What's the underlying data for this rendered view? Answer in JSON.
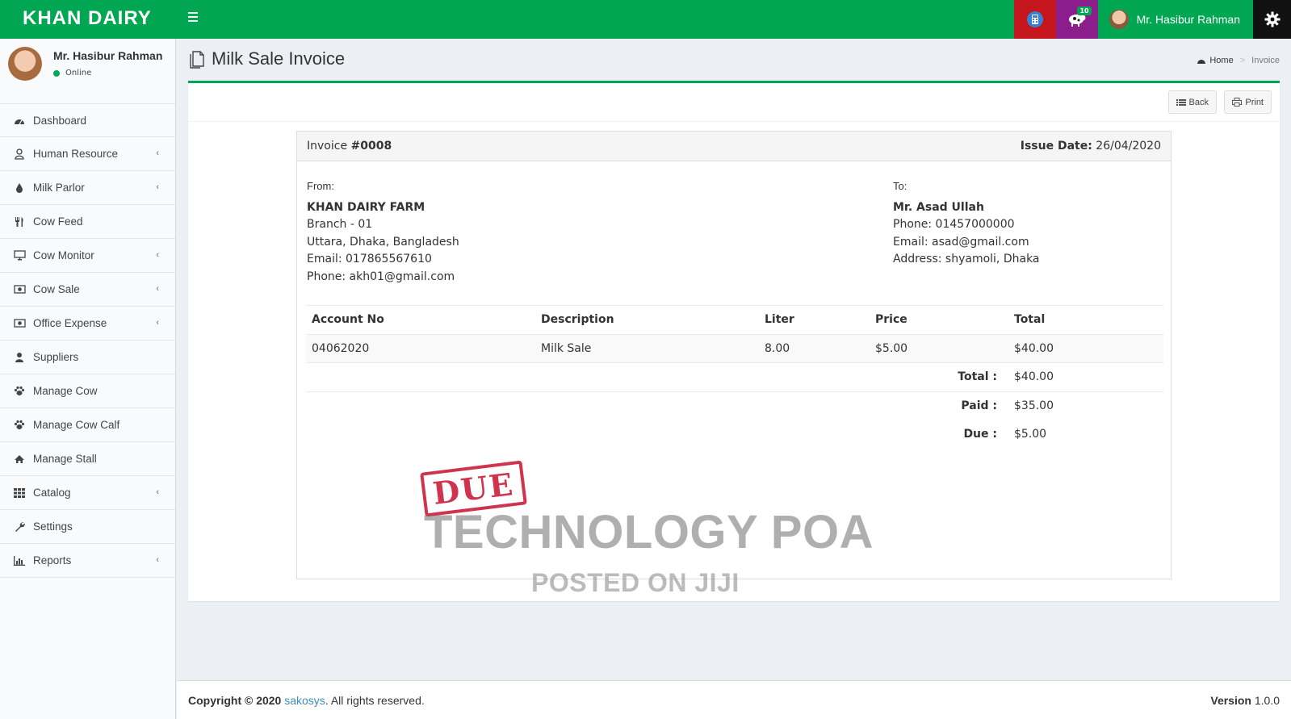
{
  "app": {
    "logo": "KHAN DAIRY"
  },
  "header": {
    "user_name": "Mr. Hasibur Rahman",
    "cow_badge": "10"
  },
  "sidebar": {
    "user_name": "Mr. Hasibur Rahman",
    "status": "Online",
    "items": [
      {
        "label": "Dashboard",
        "icon": "dashboard-icon",
        "has_children": false
      },
      {
        "label": "Human Resource",
        "icon": "user-icon",
        "has_children": true
      },
      {
        "label": "Milk Parlor",
        "icon": "tint-icon",
        "has_children": true
      },
      {
        "label": "Cow Feed",
        "icon": "cutlery-icon",
        "has_children": false
      },
      {
        "label": "Cow Monitor",
        "icon": "desktop-icon",
        "has_children": true
      },
      {
        "label": "Cow Sale",
        "icon": "money-icon",
        "has_children": true
      },
      {
        "label": "Office Expense",
        "icon": "money-icon",
        "has_children": true
      },
      {
        "label": "Suppliers",
        "icon": "user-solid-icon",
        "has_children": false
      },
      {
        "label": "Manage Cow",
        "icon": "paw-icon",
        "has_children": false
      },
      {
        "label": "Manage Cow Calf",
        "icon": "paw-icon",
        "has_children": false
      },
      {
        "label": "Manage Stall",
        "icon": "home-icon",
        "has_children": false
      },
      {
        "label": "Catalog",
        "icon": "grid-icon",
        "has_children": true
      },
      {
        "label": "Settings",
        "icon": "wrench-icon",
        "has_children": false
      },
      {
        "label": "Reports",
        "icon": "bar-chart-icon",
        "has_children": true
      }
    ]
  },
  "page": {
    "title": "Milk Sale Invoice"
  },
  "breadcrumb": {
    "home": "Home",
    "current": "Invoice"
  },
  "toolbar": {
    "back_label": "Back",
    "print_label": "Print"
  },
  "invoice": {
    "label": "Invoice",
    "number": "#0008",
    "issue_date_label": "Issue Date:",
    "issue_date": "26/04/2020",
    "from": {
      "label": "From:",
      "name": "KHAN DAIRY FARM",
      "lines": [
        "Branch - 01",
        "Uttara, Dhaka, Bangladesh",
        "Email: 017865567610",
        "Phone: akh01@gmail.com"
      ]
    },
    "to": {
      "label": "To:",
      "name": "Mr. Asad Ullah",
      "lines": [
        "Phone: 01457000000",
        "Email: asad@gmail.com",
        "Address: shyamoli, Dhaka"
      ]
    },
    "columns": [
      "Account No",
      "Description",
      "Liter",
      "Price",
      "Total"
    ],
    "rows": [
      [
        "04062020",
        "Milk Sale",
        "8.00",
        "$5.00",
        "$40.00"
      ]
    ],
    "summary": [
      {
        "label": "Total :",
        "value": "$40.00"
      },
      {
        "label": "Paid :",
        "value": "$35.00"
      },
      {
        "label": "Due :",
        "value": "$5.00"
      }
    ],
    "stamp": "DUE"
  },
  "watermark": {
    "line1": "TECHNOLOGY POA",
    "line2": "POSTED ON JIJI"
  },
  "footer": {
    "copyright_prefix": "Copyright © 2020",
    "company": "sakosys",
    "rights": ". All rights reserved.",
    "version_label": "Version",
    "version": "1.0.0"
  },
  "colors": {
    "brand_green": "#00a651",
    "calc_red": "#c4161c",
    "cow_purple": "#8c1d8d",
    "stamp_red": "#c8102e",
    "link_blue": "#3c8dbc"
  }
}
